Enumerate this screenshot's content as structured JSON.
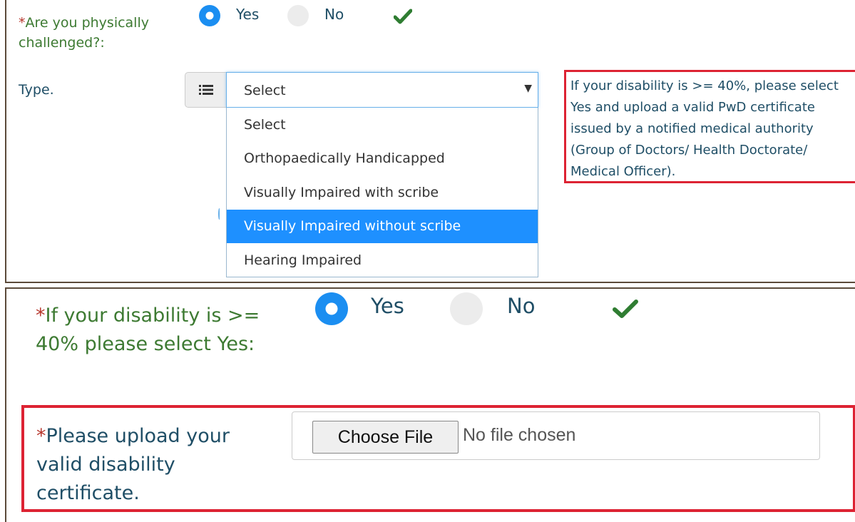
{
  "question1": {
    "asterisk": "*",
    "label": "Are you physically challenged?:",
    "yes_label": "Yes",
    "no_label": "No",
    "selected": "Yes"
  },
  "type_field": {
    "label": "Type.",
    "selected_value": "Select",
    "arrow": "▼",
    "options": [
      "Select",
      "Orthopaedically Handicapped",
      "Visually Impaired with scribe",
      "Visually Impaired without scribe",
      "Hearing Impaired"
    ],
    "highlighted_option": "Visually Impaired without scribe"
  },
  "info_note": {
    "text": "If your disability is >= 40%, please select Yes and upload a valid PwD certificate issued by a notified medical authority (Group of Doctors/ Health Doctorate/ Medical Officer)."
  },
  "question2": {
    "asterisk": "*",
    "label": "If your disability is >= 40% please select Yes:",
    "yes_label": "Yes",
    "no_label": "No",
    "selected": "Yes"
  },
  "upload": {
    "asterisk": "*",
    "label": "Please upload your valid disability certificate.",
    "button_label": "Choose File",
    "status_text": "No file chosen"
  },
  "colors": {
    "accent_blue": "#1b8ef1",
    "highlight_blue": "#1e90ff",
    "alert_red": "#dd2333",
    "label_green": "#3d7a32",
    "text_blue": "#1f4e66",
    "check_green": "#2f7d32"
  },
  "icons": {
    "valid": "checkmark-icon",
    "type_addon": "list-icon",
    "select_arrow": "caret-down-icon"
  }
}
